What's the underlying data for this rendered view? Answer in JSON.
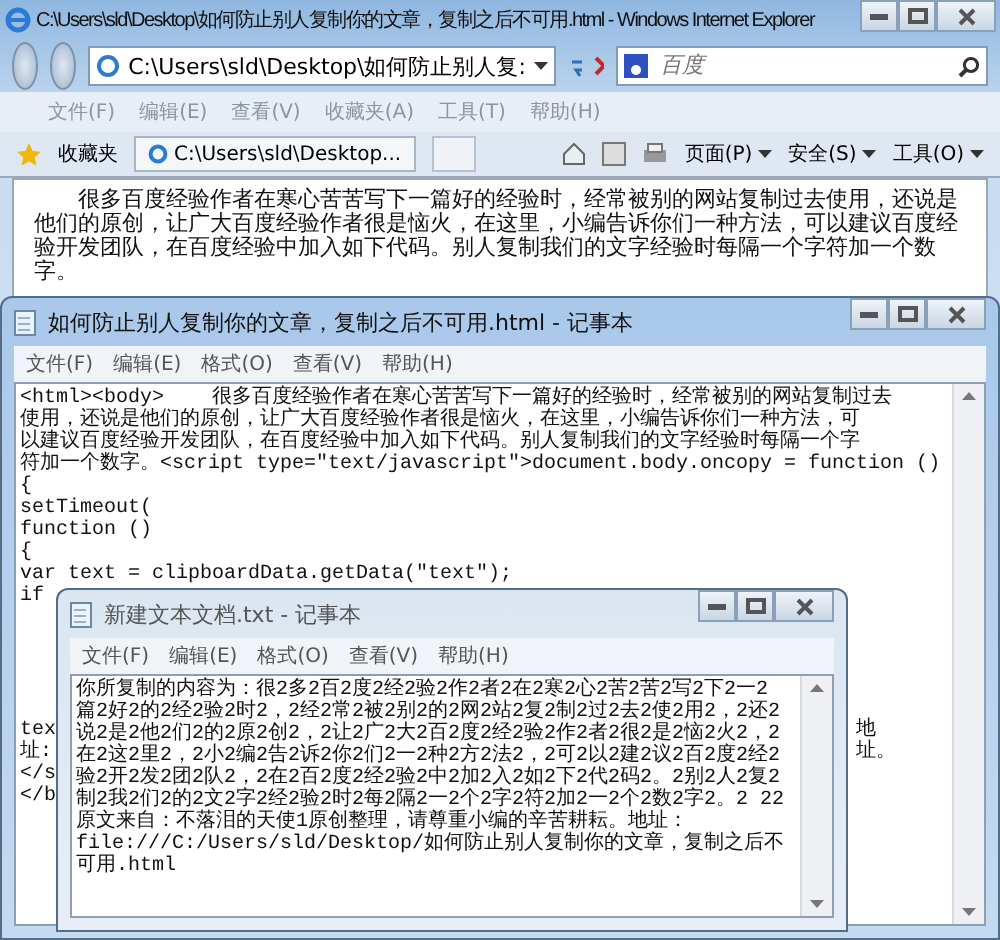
{
  "browser": {
    "title": "C:\\Users\\sld\\Desktop\\如何防止别人复制你的文章，复制之后不可用.html - Windows Internet Explorer",
    "address": "C:\\Users\\sld\\Desktop\\如何防止别人复:",
    "search_placeholder": "百度",
    "menu": [
      "文件(F)",
      "编辑(E)",
      "查看(V)",
      "收藏夹(A)",
      "工具(T)",
      "帮助(H)"
    ],
    "favorites": "收藏夹",
    "tab": "C:\\Users\\sld\\Desktop...",
    "toolbar": [
      "页面(P)",
      "安全(S)",
      "工具(O)"
    ],
    "content": "很多百度经验作者在寒心苦苦写下一篇好的经验时，经常被别的网站复制过去使用，还说是他们的原创，让广大百度经验作者很是恼火，在这里，小编告诉你们一种方法，可以建议百度经验开发团队，在百度经验中加入如下代码。别人复制我们的文字经验时每隔一个字符加一个数字。"
  },
  "notepads": [
    {
      "title": "如何防止别人复制你的文章，复制之后不可用.html - 记事本",
      "active": true,
      "menu": [
        "文件(F)",
        "编辑(E)",
        "格式(O)",
        "查看(V)",
        "帮助(H)"
      ],
      "lines": [
        "<html><body>    很多百度经验作者在寒心苦苦写下一篇好的经验时，经常被别的网站复制过去",
        "使用，还说是他们的原创，让广大百度经验作者很是恼火，在这里，小编告诉你们一种方法，可",
        "以建议百度经验开发团队，在百度经验中加入如下代码。别人复制我们的文字经验时每隔一个字",
        "符加一个数字。<script type=\"text/javascript\">document.body.oncopy = function ()",
        "{",
        "setTimeout(",
        "function ()",
        "{",
        "var text = clipboardData.getData(\"text\");",
        "if"
      ],
      "partial_lines": [
        {
          "left": "tex",
          "right": "地"
        },
        {
          "left": "址:",
          "right": "址。"
        },
        {
          "left": "</s"
        },
        {
          "left": "</b"
        }
      ]
    },
    {
      "title": "新建文本文档.txt - 记事本",
      "active": false,
      "menu": [
        "文件(F)",
        "编辑(E)",
        "格式(O)",
        "查看(V)",
        "帮助(H)"
      ],
      "lines": [
        "你所复制的内容为：很2多2百2度2经2验2作2者2在2寒2心2苦2苦2写2下2一2",
        "篇2好2的2经2验2时2，2经2常2被2别2的2网2站2复2制2过2去2使2用2，2还2",
        "说2是2他2们2的2原2创2，2让2广2大2百2度2经2验2作2者2很2是2恼2火2，2",
        "在2这2里2，2小2编2告2诉2你2们2一2种2方2法2，2可2以2建2议2百2度2经2",
        "验2开2发2团2队2，2在2百2度2经2验2中2加2入2如2下2代2码2。2别2人2复2",
        "制2我2们2的2文2字2经2验2时2每2隔2一2个2字2符2加2一2个2数2字2。2 22",
        "原文来自：不落泪的天使1原创整理，请尊重小编的辛苦耕耘。地址：",
        "file:///C:/Users/sld/Desktop/如何防止别人复制你的文章，复制之后不",
        "可用.html"
      ]
    }
  ]
}
